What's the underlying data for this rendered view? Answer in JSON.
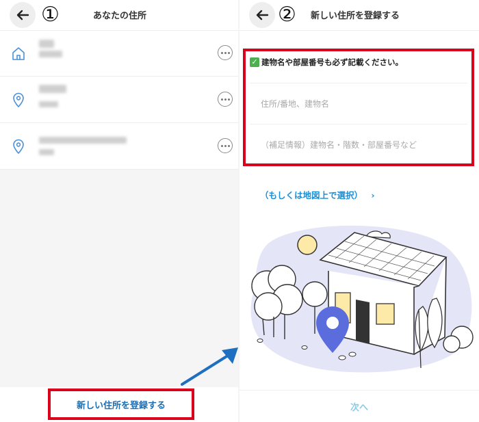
{
  "left": {
    "step": "①",
    "title": "あなたの住所",
    "new_address_button": "新しい住所を登録する"
  },
  "right": {
    "step": "②",
    "title": "新しい住所を登録する",
    "notice": "建物名や部屋番号も必ず記載ください。",
    "field1_placeholder": "住所/番地、建物名",
    "field2_placeholder": "（補足情報）建物名・階数・部屋番号など",
    "map_link": "（もしくは地図上で選択）",
    "map_link_arrow": "›",
    "next_button": "次へ"
  },
  "colors": {
    "accent_red": "#d9001b",
    "link_blue": "#1a8fd6",
    "pin_blue": "#5b6cdc"
  },
  "icons": [
    "back-arrow-icon",
    "home-icon",
    "location-pin-icon",
    "more-options-icon",
    "check-icon"
  ]
}
